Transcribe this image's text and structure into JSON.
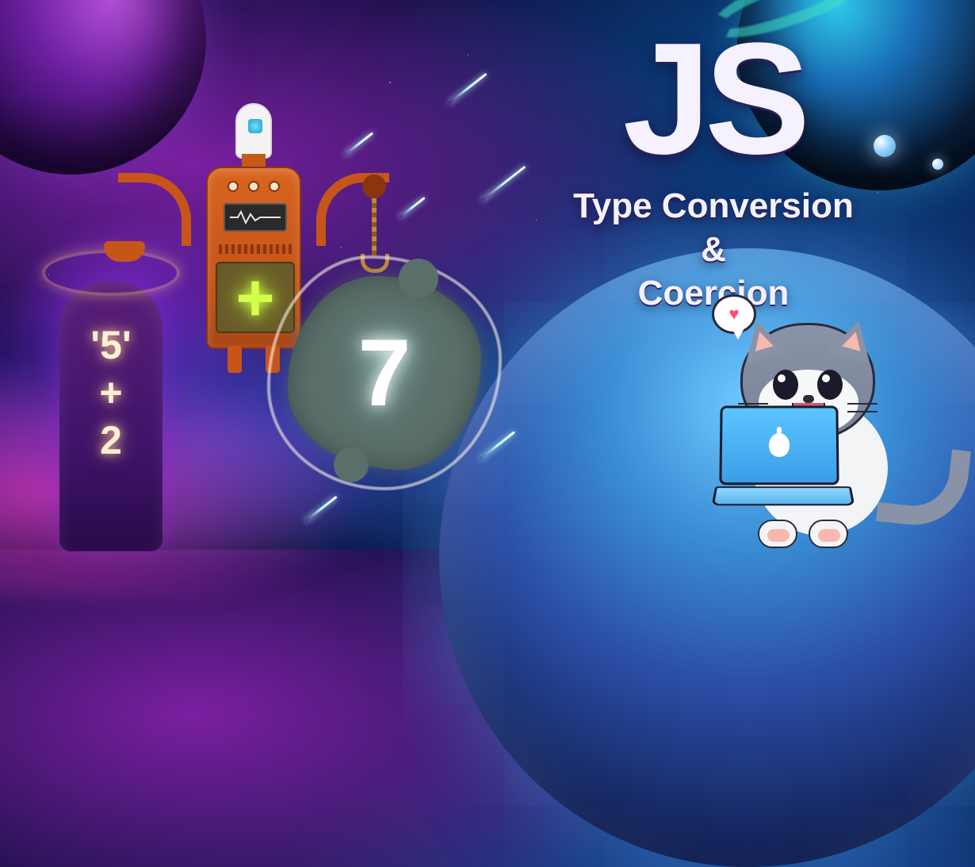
{
  "headline": {
    "title": "JS",
    "subtitle_line1": "Type Conversion",
    "subtitle_line2": "&",
    "subtitle_line3": "Coercion"
  },
  "expression": {
    "line1": "'5'",
    "line2": "+",
    "line3": "2"
  },
  "robot": {
    "operator": "+"
  },
  "result": {
    "value": "7"
  },
  "cat": {
    "speech_icon": "♥"
  }
}
